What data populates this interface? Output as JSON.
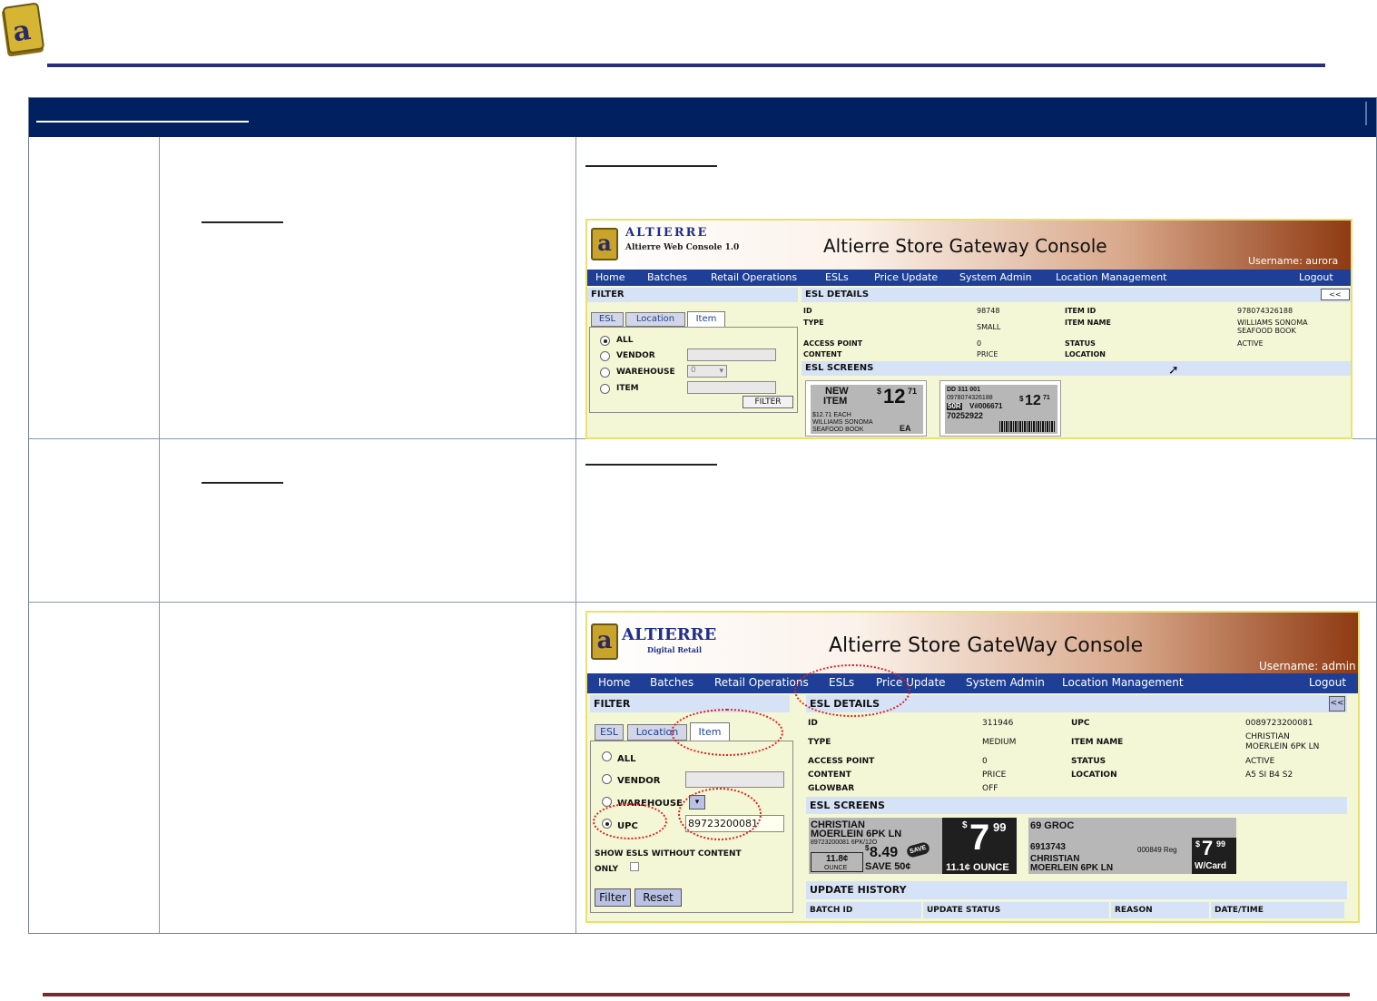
{
  "top_console": {
    "brand": "ALTIERRE",
    "subbrand": "Altierre Web Console 1.0",
    "title": "Altierre Store Gateway Console",
    "username": "Username: aurora",
    "menu": [
      "Home",
      "Batches",
      "Retail Operations",
      "ESLs",
      "Price Update",
      "System Admin",
      "Location Management",
      "Logout"
    ],
    "filter_header": "FILTER",
    "tabs": [
      "ESL",
      "Location",
      "Item"
    ],
    "radios": [
      "ALL",
      "VENDOR",
      "WAREHOUSE",
      "ITEM"
    ],
    "warehouse_value": "0",
    "filter_button": "FILTER",
    "details_header": "ESL DETAILS",
    "collapse_button": "<<",
    "details": {
      "id_label": "ID",
      "id_value": "98748",
      "type_label": "TYPE",
      "type_value": "SMALL",
      "access_label": "ACCESS POINT",
      "access_value": "0",
      "content_label": "CONTENT",
      "content_value": "PRICE",
      "item_id_label": "ITEM ID",
      "item_id_value": "978074326188",
      "item_name_label": "ITEM NAME",
      "item_name_value_1": "WILLIAMS SONOMA",
      "item_name_value_2": "SEAFOOD BOOK",
      "status_label": "STATUS",
      "status_value": "ACTIVE",
      "location_label": "LOCATION"
    },
    "screens_header": "ESL SCREENS",
    "screen1": {
      "line1": "NEW",
      "line2": "ITEM",
      "price_sup": "$",
      "price_main": "12",
      "price_cents": "71",
      "sub1": "$12.71   EACH",
      "sub2": "WILLIAMS SONOMA",
      "sub3": "SEAFOOD BOOK",
      "unit": "EA"
    },
    "screen2": {
      "line1": "DD   311   001",
      "line2": "0978074326188",
      "tag": "50R",
      "vendor": "V#006671",
      "code": "70252922",
      "price_sup": "$",
      "price_main": "12",
      "price_cents": "71"
    }
  },
  "bottom_console": {
    "brand": "ALTIERRE",
    "subbrand": "Digital Retail",
    "title": "Altierre Store GateWay Console",
    "username": "Username: admin",
    "menu": [
      "Home",
      "Batches",
      "Retail Operations",
      "ESLs",
      "Price Update",
      "System Admin",
      "Location Management",
      "Logout"
    ],
    "filter_header": "FILTER",
    "tabs": [
      "ESL",
      "Location",
      "Item"
    ],
    "radios": [
      "ALL",
      "VENDOR",
      "WAREHOUSE",
      "UPC"
    ],
    "upc_value": "89723200081",
    "show_label_1": "SHOW ESLS WITHOUT CONTENT",
    "show_label_2": "ONLY",
    "filter_button": "Filter",
    "reset_button": "Reset",
    "details_header": "ESL DETAILS",
    "collapse_button": "<<",
    "details": {
      "id_label": "ID",
      "id_value": "311946",
      "type_label": "TYPE",
      "type_value": "MEDIUM",
      "access_label": "ACCESS POINT",
      "access_value": "0",
      "content_label": "CONTENT",
      "content_value": "PRICE",
      "glowbar_label": "GLOWBAR",
      "glowbar_value": "OFF",
      "upc_label": "UPC",
      "upc_value": "0089723200081",
      "item_name_label": "ITEM NAME",
      "item_name_value_1": "CHRISTIAN",
      "item_name_value_2": "MOERLEIN 6PK LN",
      "status_label": "STATUS",
      "status_value": "ACTIVE",
      "location_label": "LOCATION",
      "location_value": "A5 SI B4 S2"
    },
    "screens_header": "ESL SCREENS",
    "screen1": {
      "line1": "CHRISTIAN",
      "line2": "MOERLEIN 6PK LN",
      "line3": "89723200081  6PK/12O",
      "unit_price": "11.8¢",
      "unit": "OUNCE",
      "price_sup": "$",
      "price_main": "8.49",
      "save_badge": "SAVE",
      "save_text": "SAVE 50¢",
      "big_sup": "$",
      "big_main": "7",
      "big_cents": "99",
      "big_unit": "11.1¢ OUNCE"
    },
    "screen2": {
      "line1": "69   GROC",
      "line2": "6913743",
      "reg": "000849 Reg",
      "line3": "CHRISTIAN",
      "line4": "MOERLEIN 6PK LN",
      "big_sup": "$",
      "big_main": "7",
      "big_cents": "99",
      "card": "W/Card"
    },
    "history_header": "UPDATE HISTORY",
    "history_columns": [
      "BATCH ID",
      "UPDATE STATUS",
      "REASON",
      "DATE/TIME"
    ]
  }
}
